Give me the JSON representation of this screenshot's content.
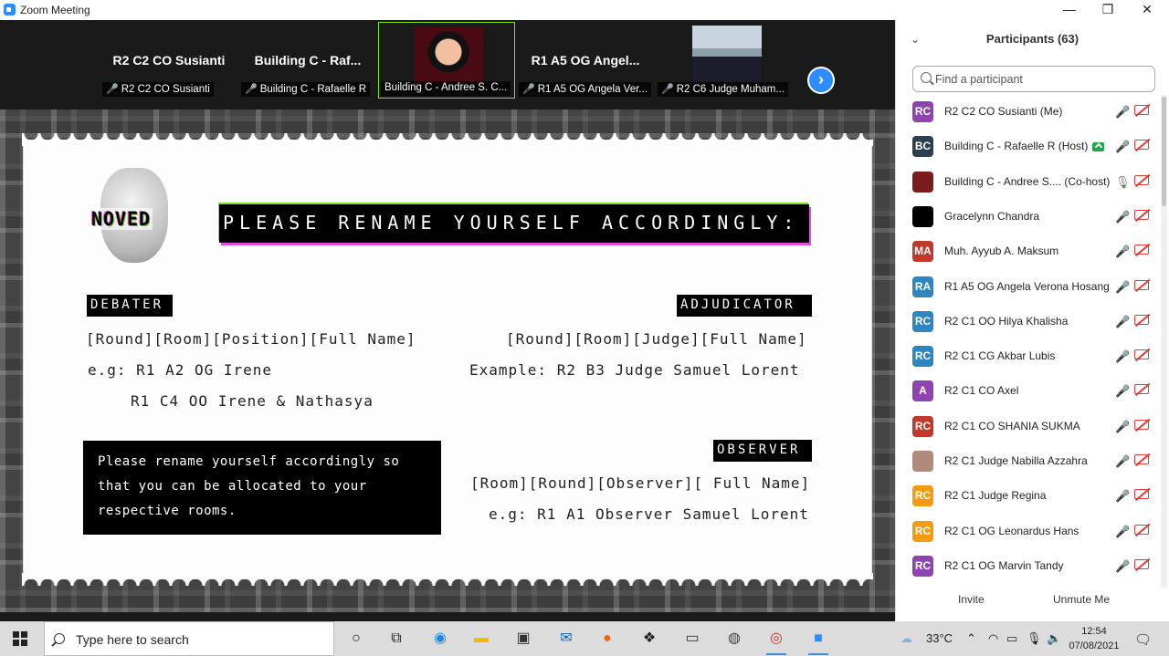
{
  "window": {
    "title": "Zoom Meeting",
    "minimize": "—",
    "maximize": "❐",
    "close": "✕"
  },
  "videos": [
    {
      "big_name": "R2 C2 CO Susianti",
      "label": "R2 C2 CO Susianti"
    },
    {
      "big_name": "Building C - Raf...",
      "label": "Building C - Rafaelle R"
    },
    {
      "big_name": "",
      "label": "Building C - Andree S. C..."
    },
    {
      "big_name": "R1 A5 OG Angel...",
      "label": "R1 A5 OG Angela Ver..."
    },
    {
      "big_name": "",
      "label": "R2 C6 Judge Muham..."
    }
  ],
  "next_page_icon": "chevron-right-icon",
  "slide": {
    "logo": "NOVED",
    "banner": "PLEASE RENAME YOURSELF ACCORDINGLY:",
    "debater_tag": "DEBATER",
    "debater_format": "[Round][Room][Position][Full Name]",
    "debater_example1": "e.g: R1 A2 OG Irene",
    "debater_example2": "R1 C4 OO Irene & Nathasya",
    "adjudicator_tag": "ADJUDICATOR",
    "adjudicator_format": "[Round][Room][Judge][Full Name]",
    "adjudicator_example": "Example: R2 B3 Judge Samuel Lorent",
    "note": "Please rename yourself accordingly so that you can be allocated to your respective rooms.",
    "observer_tag": "OBSERVER",
    "observer_format": "[Room][Round][Observer][ Full Name]",
    "observer_example": "e.g: R1 A1 Observer Samuel Lorent"
  },
  "participants_panel": {
    "title": "Participants (63)",
    "search_placeholder": "Find a participant",
    "invite": "Invite",
    "unmute_me": "Unmute Me",
    "items": [
      {
        "initials": "RC",
        "color": "#8e44ad",
        "name": "R2 C2 CO Susianti (Me)",
        "mic": "off"
      },
      {
        "initials": "BC",
        "color": "#2c3e50",
        "name": "Building C - Rafaelle R (Host)",
        "mic": "off",
        "badge": true
      },
      {
        "initials": "",
        "color": "#7a1d1d",
        "name": "Building C - Andree S.... (Co-host)",
        "mic": "on"
      },
      {
        "initials": "",
        "color": "#000000",
        "name": "Gracelynn Chandra",
        "mic": "off"
      },
      {
        "initials": "MA",
        "color": "#c0392b",
        "name": "Muh. Ayyub A. Maksum",
        "mic": "off"
      },
      {
        "initials": "RA",
        "color": "#2e86c1",
        "name": "R1 A5 OG Angela Verona Hosang",
        "mic": "off"
      },
      {
        "initials": "RC",
        "color": "#2e86c1",
        "name": "R2 C1  OO Hilya Khalisha",
        "mic": "off"
      },
      {
        "initials": "RC",
        "color": "#2e86c1",
        "name": "R2 C1 CG Akbar Lubis",
        "mic": "off"
      },
      {
        "initials": "A",
        "color": "#8e44ad",
        "name": "R2 C1 CO Axel",
        "mic": "off"
      },
      {
        "initials": "RC",
        "color": "#c0392b",
        "name": "R2 C1 CO SHANIA SUKMA",
        "mic": "off"
      },
      {
        "initials": "",
        "color": "#b08a7a",
        "name": "R2 C1 Judge Nabilla Azzahra",
        "mic": "off"
      },
      {
        "initials": "RC",
        "color": "#f39c12",
        "name": "R2 C1 Judge Regina",
        "mic": "off"
      },
      {
        "initials": "RC",
        "color": "#f39c12",
        "name": "R2 C1 OG Leonardus Hans",
        "mic": "off"
      },
      {
        "initials": "RC",
        "color": "#8e44ad",
        "name": "R2 C1 OG Marvin Tandy",
        "mic": "off"
      }
    ]
  },
  "taskbar": {
    "search_placeholder": "Type here to search",
    "temperature": "33°C",
    "time": "12:54",
    "date": "07/08/2021",
    "icons": [
      "cortana-icon",
      "task-view-icon",
      "edge-icon",
      "file-explorer-icon",
      "store-icon",
      "mail-icon",
      "firefox-icon",
      "dropbox-icon",
      "amazon-icon",
      "camera-icon",
      "chrome-icon",
      "zoom-icon"
    ]
  }
}
